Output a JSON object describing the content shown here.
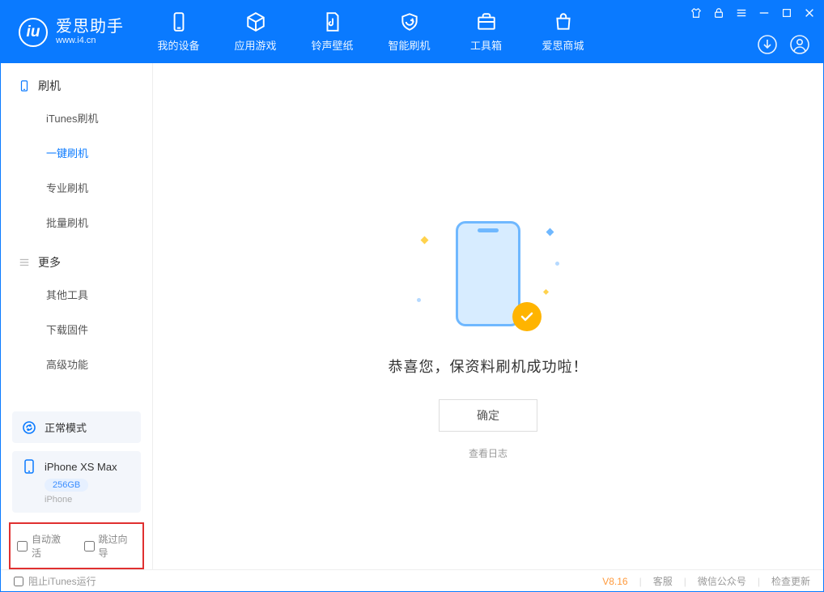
{
  "app": {
    "name_cn": "爱思助手",
    "url": "www.i4.cn"
  },
  "topnav": {
    "device": "我的设备",
    "apps": "应用游戏",
    "ringtone": "铃声壁纸",
    "flash": "智能刷机",
    "toolbox": "工具箱",
    "store": "爱思商城"
  },
  "sidebar": {
    "group_flash": "刷机",
    "items_flash": {
      "itunes": "iTunes刷机",
      "onekey": "一键刷机",
      "pro": "专业刷机",
      "batch": "批量刷机"
    },
    "group_more": "更多",
    "items_more": {
      "other": "其他工具",
      "firmware": "下载固件",
      "advanced": "高级功能"
    },
    "mode_status": "正常模式",
    "device_name": "iPhone XS Max",
    "device_capacity": "256GB",
    "device_type": "iPhone",
    "checkbox_auto_activate": "自动激活",
    "checkbox_skip_guide": "跳过向导"
  },
  "main": {
    "success_message": "恭喜您，保资料刷机成功啦！",
    "confirm_button": "确定",
    "view_log": "查看日志"
  },
  "footer": {
    "block_itunes": "阻止iTunes运行",
    "version": "V8.16",
    "service": "客服",
    "wechat": "微信公众号",
    "update": "检查更新"
  }
}
